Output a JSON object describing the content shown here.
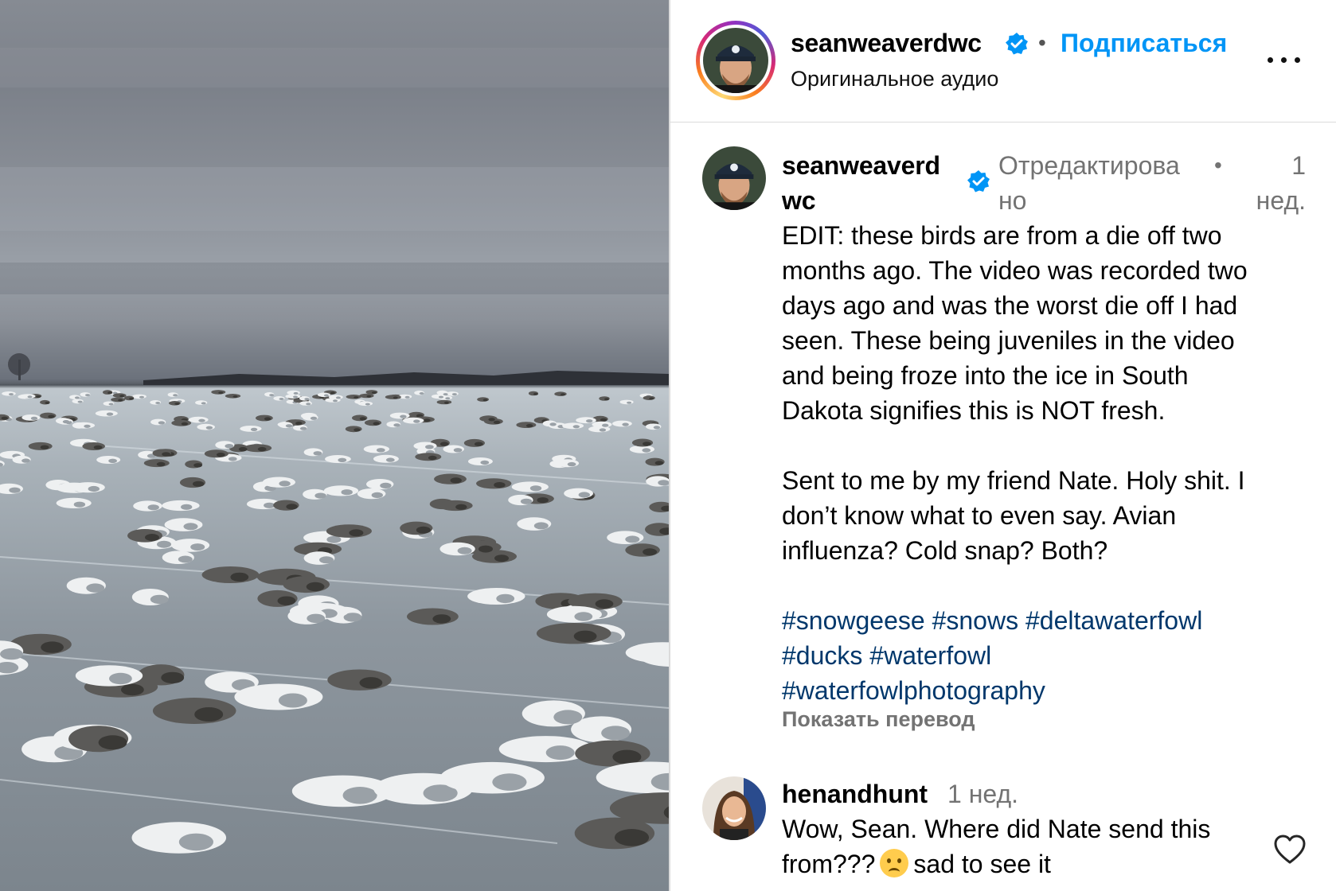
{
  "post": {
    "media_alt": "dead snow geese frozen into ice on a lake under an overcast sky"
  },
  "header": {
    "username": "seanweaverdwc",
    "separator": "•",
    "follow_label": "Подписаться",
    "subtitle": "Оригинальное аудио",
    "more_icon": "more-horizontal-icon"
  },
  "caption": {
    "username_line1": "seanweaverd",
    "username_line2": "wc",
    "edited_line1": "Отредактирова",
    "edited_line2": "но",
    "separator": "•",
    "time_line1": "1",
    "time_line2": "нед.",
    "paragraph1": [
      "EDIT: these birds are from a die off two",
      "months ago. The video was recorded two",
      "days ago and was the worst die off I had",
      "seen. These being juveniles in the video",
      "and being froze into the ice in South",
      "Dakota signifies this is NOT fresh."
    ],
    "paragraph2": [
      "Sent to me by my friend Nate. Holy shit. I",
      "don’t know what to even say. Avian",
      "influenza? Cold snap? Both?"
    ],
    "hashtags": [
      "#snowgeese",
      "#snows",
      "#deltawaterfowl",
      "#ducks",
      "#waterfowl",
      "#waterfowlphotography"
    ],
    "translate_label": "Показать перевод"
  },
  "comment": {
    "username": "henandhunt",
    "time": "1 нед.",
    "text_line1": "Wow, Sean. Where did Nate send this",
    "text_line2_before": "from???",
    "emoji": "crying-face-emoji",
    "text_line2_after": "sad to see it",
    "like_icon": "heart-icon"
  },
  "colors": {
    "accent": "#0095f6",
    "hashtag": "#00376b",
    "secondary_text": "#737373",
    "verified": "#0095f6"
  }
}
